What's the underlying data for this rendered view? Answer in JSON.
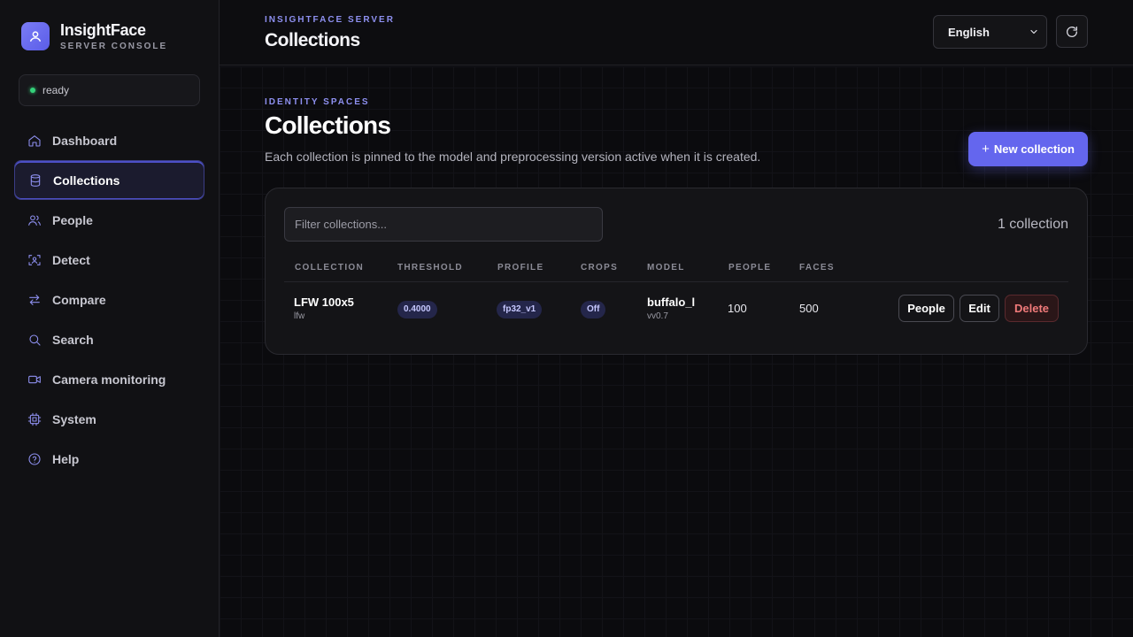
{
  "brand": {
    "name": "InsightFace",
    "subtitle": "SERVER CONSOLE"
  },
  "status": {
    "text": "ready",
    "color": "#34d27a"
  },
  "sidebar": {
    "items": [
      {
        "label": "Dashboard",
        "icon": "home-icon"
      },
      {
        "label": "Collections",
        "icon": "database-icon",
        "active": true
      },
      {
        "label": "People",
        "icon": "users-icon"
      },
      {
        "label": "Detect",
        "icon": "scan-face-icon"
      },
      {
        "label": "Compare",
        "icon": "arrows-swap-icon"
      },
      {
        "label": "Search",
        "icon": "search-icon"
      },
      {
        "label": "Camera monitoring",
        "icon": "video-camera-icon"
      },
      {
        "label": "System",
        "icon": "cpu-icon"
      },
      {
        "label": "Help",
        "icon": "help-circle-icon"
      }
    ]
  },
  "header": {
    "eyebrow": "INSIGHTFACE SERVER",
    "title": "Collections",
    "language": "English"
  },
  "main": {
    "eyebrow": "IDENTITY SPACES",
    "title": "Collections",
    "description": "Each collection is pinned to the model and preprocessing version active when it is created.",
    "new_button": "New collection",
    "filter_placeholder": "Filter collections...",
    "count": "1 collection",
    "columns": [
      "COLLECTION",
      "THRESHOLD",
      "PROFILE",
      "CROPS",
      "MODEL",
      "PEOPLE",
      "FACES"
    ],
    "rows": [
      {
        "name": "LFW 100x5",
        "slug": "lfw",
        "threshold": "0.4000",
        "profile": "fp32_v1",
        "crops": "Off",
        "model": "buffalo_l",
        "model_version": "vv0.7",
        "people": "100",
        "faces": "500",
        "actions": {
          "people": "People",
          "edit": "Edit",
          "delete": "Delete"
        }
      }
    ]
  },
  "colors": {
    "accent": "#6466ee",
    "danger": "#f07a7a",
    "background": "#0b0b0e"
  }
}
